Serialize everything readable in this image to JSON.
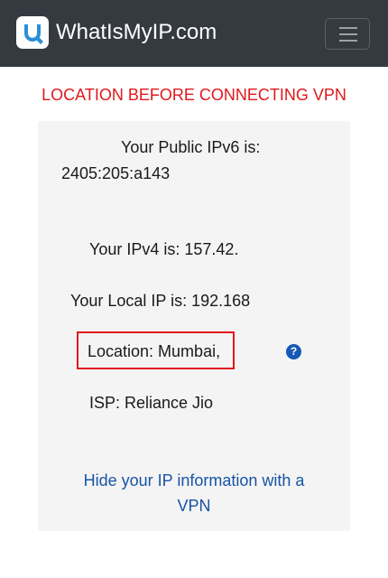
{
  "navbar": {
    "brand_text": "WhatIsMyIP.com",
    "logo_icon": "q-logo-icon",
    "menu_icon": "hamburger-menu-icon"
  },
  "heading": "LOCATION BEFORE CONNECTING VPN",
  "info": {
    "ipv6_label": "Your Public IPv6 is:",
    "ipv6_value": "2405:205:a143",
    "ipv4": "Your IPv4 is: 157.42.",
    "local_ip": "Your Local IP is: 192.168",
    "location": "Location: Mumbai,",
    "isp": "ISP: Reliance Jio",
    "help_icon": "question-circle-icon"
  },
  "vpn_link": {
    "line1": "Hide your IP information with a",
    "line2": "VPN"
  },
  "colors": {
    "navbar_bg": "#343a40",
    "heading_red": "#e0181d",
    "link_blue": "#1654a6",
    "card_bg": "#f4f4f4"
  }
}
